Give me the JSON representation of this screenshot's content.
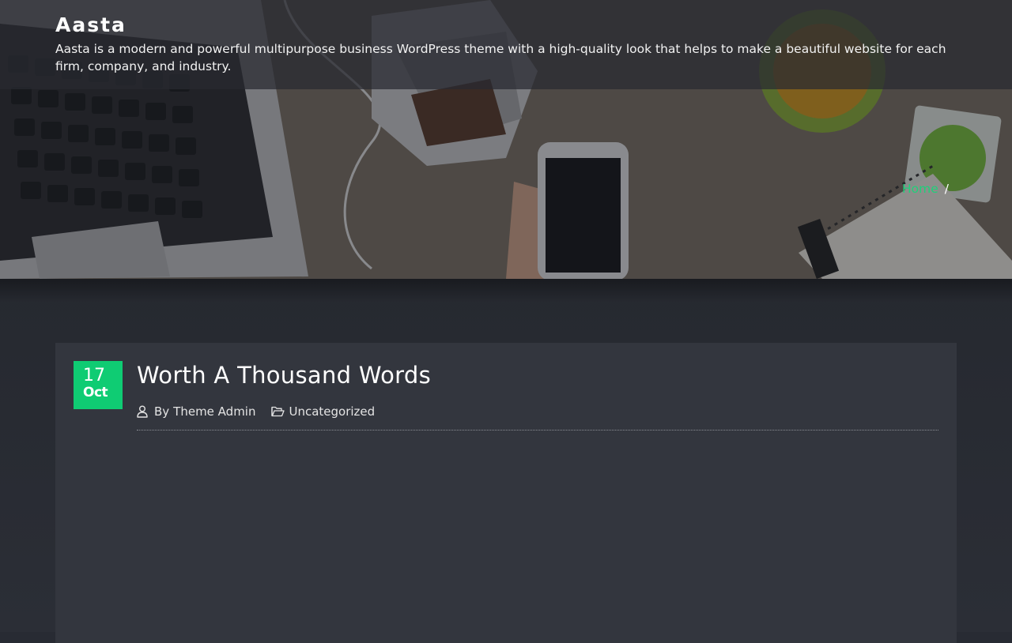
{
  "site": {
    "title": "Aasta",
    "description": "Aasta is a modern and powerful multipurpose business WordPress theme with a high-quality look that helps to make a beautiful website for each firm, company, and industry."
  },
  "breadcrumb": {
    "home_label": "Home",
    "separator": "/"
  },
  "post": {
    "date_day": "17",
    "date_month": "Oct",
    "title": "Worth A Thousand Words",
    "author_prefix": "By",
    "author": "Theme Admin",
    "category": "Uncategorized"
  },
  "icons": {
    "author": "user-icon",
    "category": "folder-open-icon"
  },
  "colors": {
    "accent": "#0fcc73",
    "breadcrumb_link": "#1fd07a",
    "page_background": "#282b33",
    "card_background": "#33363e",
    "header_overlay": "#2a2c31"
  }
}
